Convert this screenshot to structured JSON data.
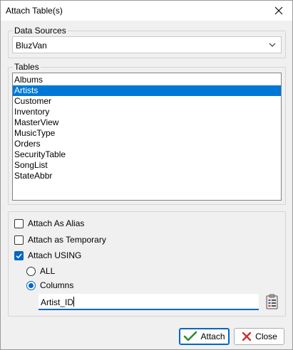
{
  "window": {
    "title": "Attach Table(s)"
  },
  "data_sources": {
    "group_label": "Data Sources",
    "selected_value": "BluzVan"
  },
  "tables": {
    "group_label": "Tables",
    "items": [
      "Albums",
      "Artists",
      "Customer",
      "Inventory",
      "MasterView",
      "MusicType",
      "Orders",
      "SecurityTable",
      "SongList",
      "StateAbbr"
    ],
    "selected": "Artists"
  },
  "options": {
    "attach_as_alias": {
      "label": "Attach As Alias",
      "checked": false
    },
    "attach_as_temporary": {
      "label": "Attach as Temporary",
      "checked": false
    },
    "attach_using": {
      "label": "Attach USING",
      "checked": true
    },
    "radio_all": {
      "label": "ALL",
      "checked": false
    },
    "radio_columns": {
      "label": "Columns",
      "checked": true
    },
    "columns_value": "Artist_ID"
  },
  "buttons": {
    "attach_label": "Attach",
    "close_label": "Close"
  },
  "colors": {
    "accent": "#0067c0",
    "selection": "#0078d7",
    "close_red": "#d32f2f",
    "check_green": "#2e8b2e"
  }
}
